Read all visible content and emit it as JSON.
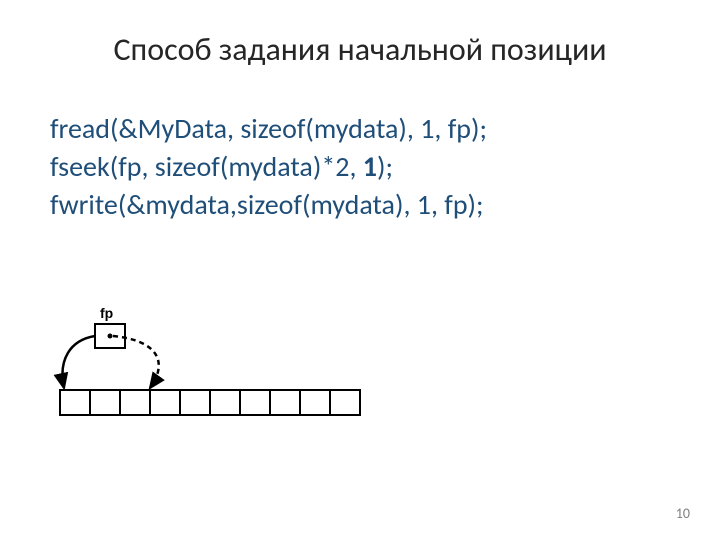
{
  "title": "Способ задания начальной позиции",
  "code": {
    "line1": "fread(&MyData, sizeof(mydata), 1, fp);",
    "line2_a": "fseek(fp, sizeof(mydata)*2, ",
    "line2_b": "1",
    "line2_c": ");",
    "line3": "fwrite(&mydata,sizeof(mydata), 1, fp);"
  },
  "diagram": {
    "fp_label": "fp"
  },
  "page_number": "10"
}
